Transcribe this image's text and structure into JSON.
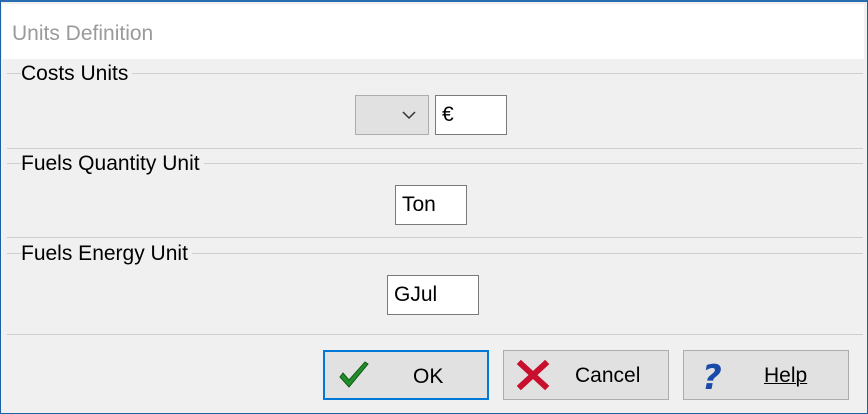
{
  "window": {
    "title": "Units Definition"
  },
  "costs": {
    "group_label": "Costs Units",
    "currency_select_value": "",
    "symbol_value": "€"
  },
  "fuels_quantity": {
    "group_label": "Fuels Quantity Unit",
    "value": "Ton"
  },
  "fuels_energy": {
    "group_label": "Fuels Energy Unit",
    "value": "GJul"
  },
  "buttons": {
    "ok": "OK",
    "cancel": "Cancel",
    "help": "Help"
  },
  "colors": {
    "accent_border": "#0078d7",
    "ok_check": "#1f8f2a",
    "cancel_x": "#c8102e",
    "help_question": "#1a4aa8"
  },
  "icons": [
    "chevron-down-icon",
    "checkmark-icon",
    "cross-icon",
    "question-mark-icon"
  ]
}
